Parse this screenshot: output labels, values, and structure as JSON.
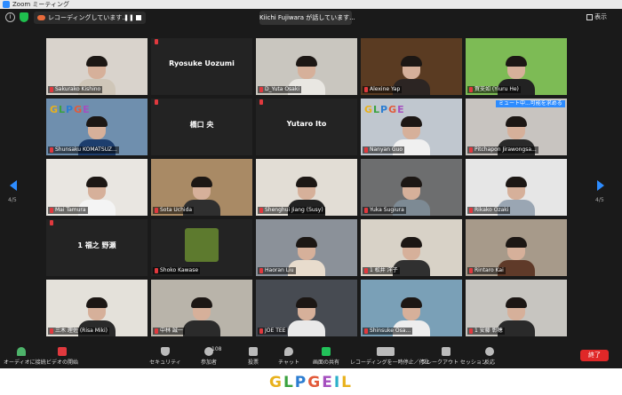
{
  "window": {
    "title": "Zoom ミーティング"
  },
  "topbar": {
    "recording_text": "レコーディングしています...",
    "pause_icon": "pause-icon",
    "speaking_text": "Kiichi Fujiwara が話しています...",
    "view_label": "表示"
  },
  "pager": {
    "left": "4/5",
    "right": "4/5"
  },
  "tiles": [
    {
      "name": "Sakurako Kishino",
      "type": "video",
      "bg": "#d9d3cc",
      "shirt": "#cfc6b8"
    },
    {
      "name": "",
      "big": "Ryosuke Uozumi",
      "type": "text"
    },
    {
      "name": "D_Yuta Osaki",
      "type": "video",
      "bg": "#c9c6bf",
      "shirt": "#e9e7e2"
    },
    {
      "name": "Alexine Yap",
      "type": "video",
      "bg": "#5a3b22",
      "shirt": "#2c2523"
    },
    {
      "name": "賀芠如 (Yiuru He)",
      "type": "video",
      "bg": "#7dbb55",
      "shirt": "#222"
    },
    {
      "name": "Shunsaku KOMATSUZ...",
      "type": "glpe",
      "bg": "#6f8fae",
      "shirt": "#1d3e6e"
    },
    {
      "name": "",
      "big": "橋口 央",
      "type": "text"
    },
    {
      "name": "",
      "big": "Yutaro Ito",
      "type": "text"
    },
    {
      "name": "Nanyan Guo",
      "type": "glpe",
      "bg": "#c0c7cf",
      "shirt": "#f0f0f0"
    },
    {
      "name": "Pitchapon Jirawongsa...",
      "type": "video",
      "bg": "#c8c4c0",
      "shirt": "#2a2a2a"
    },
    {
      "name": "Mai Tamura",
      "type": "video",
      "bg": "#e9e6e1",
      "shirt": "#f4f4f4"
    },
    {
      "name": "Sota Uchida",
      "type": "video",
      "bg": "#a98a65",
      "shirt": "#2f2f2f"
    },
    {
      "name": "Shenghui Jiang (Susy)",
      "type": "video",
      "bg": "#e2ddd5",
      "shirt": "#222"
    },
    {
      "name": "Yuka Sugiura",
      "type": "video",
      "bg": "#6d6e6f",
      "shirt": "#7d8a94"
    },
    {
      "name": "Rikako Ozaki",
      "type": "video",
      "bg": "#e6e6e6",
      "shirt": "#9aa6b3"
    },
    {
      "name": "",
      "big": "1 福之 野瀬",
      "type": "text"
    },
    {
      "name": "Shoko Kawase",
      "type": "plant",
      "bg": "#232323",
      "shirt": "#5d7a2e"
    },
    {
      "name": "Haoran Liu",
      "type": "video",
      "bg": "#8b9199",
      "shirt": "#e8dccd"
    },
    {
      "name": "1 松井 洋子",
      "type": "video",
      "bg": "#d8d2c7",
      "shirt": "#303030"
    },
    {
      "name": "Rintaro Kai",
      "type": "video",
      "bg": "#a79a8a",
      "shirt": "#5f3a29"
    },
    {
      "name": "三木 理佐 (Risa Miki)",
      "type": "video",
      "bg": "#e4e1da",
      "shirt": "#2a2a2a"
    },
    {
      "name": "中林 誠一",
      "type": "video",
      "bg": "#b9b4aa",
      "shirt": "#2b2b2b"
    },
    {
      "name": "JOE TEE",
      "type": "video",
      "bg": "#474b52",
      "shirt": "#e9e9e9"
    },
    {
      "name": "Shinsuke Osa...",
      "type": "video",
      "bg": "#7aa0b7",
      "shirt": "#ededed"
    },
    {
      "name": "1 安藤 彰穂",
      "type": "video",
      "bg": "#c7c5c0",
      "shirt": "#2a2a2a"
    }
  ],
  "tile_overlay": {
    "comment_text": "ミュート中...可能を求める"
  },
  "toolbar": {
    "audio": "オーディオに接続",
    "video": "ビデオの開始",
    "security": "セキュリティ",
    "participants": "参加者",
    "participants_count": "108",
    "polls": "投票",
    "chat": "チャット",
    "share": "画面の共有",
    "record": "レコーディングを一時停止／停止",
    "breakout": "ブレークアウト セッション",
    "reactions": "反応",
    "end": "終了"
  },
  "logo": {
    "text": "GLPGEIL"
  },
  "colors": {
    "accent": "#2d8cff",
    "end": "#e02828",
    "share": "#22c25a"
  }
}
